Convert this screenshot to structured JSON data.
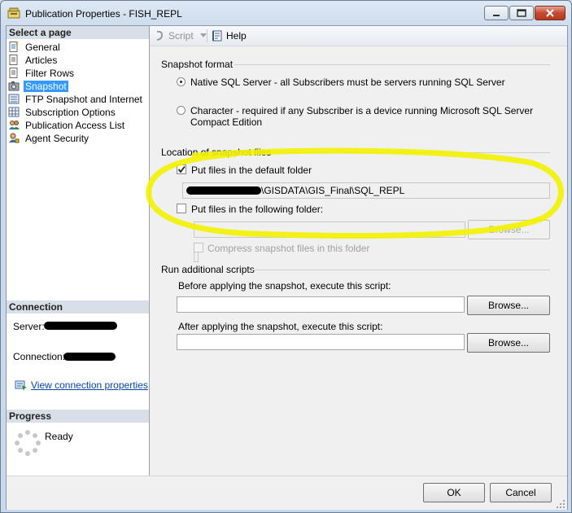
{
  "window": {
    "title": "Publication Properties - FISH_REPL"
  },
  "left_pane": {
    "select_page_header": "Select a page",
    "pages": [
      {
        "label": "General",
        "icon": "page-icon",
        "selected": false
      },
      {
        "label": "Articles",
        "icon": "page-icon",
        "selected": false
      },
      {
        "label": "Filter Rows",
        "icon": "page-icon",
        "selected": false
      },
      {
        "label": "Snapshot",
        "icon": "snapshot-icon",
        "selected": true
      },
      {
        "label": "FTP Snapshot and Internet",
        "icon": "ftp-icon",
        "selected": false
      },
      {
        "label": "Subscription Options",
        "icon": "grid-icon",
        "selected": false
      },
      {
        "label": "Publication Access List",
        "icon": "users-icon",
        "selected": false
      },
      {
        "label": "Agent Security",
        "icon": "user-lock-icon",
        "selected": false
      }
    ],
    "connection": {
      "header": "Connection",
      "server_label": "Server:",
      "connection_label": "Connection:",
      "view_link": "View connection properties"
    },
    "progress": {
      "header": "Progress",
      "status": "Ready"
    }
  },
  "toolbar": {
    "script_label": "Script",
    "help_label": "Help"
  },
  "snapshot_format": {
    "group_label": "Snapshot format",
    "native_option": "Native SQL Server - all Subscribers must be servers running SQL Server",
    "character_option_line1": "Character - required if any Subscriber is a device running Microsoft SQL Server",
    "character_option_line2": "Compact Edition",
    "native_selected": true
  },
  "location": {
    "group_label": "Location of snapshot files",
    "default_folder_label": "Put files in the default folder",
    "default_folder_checked": true,
    "default_folder_path": "\\GISDATA\\GIS_Final\\SQL_REPL",
    "following_folder_label": "Put files in the following folder:",
    "following_folder_checked": false,
    "following_folder_value": "",
    "browse_label": "Browse...",
    "compress_label": "Compress snapshot files in this folder"
  },
  "scripts": {
    "group_label": "Run additional scripts",
    "before_label": "Before applying the snapshot, execute this script:",
    "after_label": "After applying the snapshot, execute this script:",
    "before_value": "",
    "after_value": "",
    "browse_label": "Browse..."
  },
  "footer": {
    "ok_label": "OK",
    "cancel_label": "Cancel"
  },
  "colors": {
    "selection": "#3399ff",
    "highlight_marker": "#f2f200",
    "link": "#0645ad"
  }
}
